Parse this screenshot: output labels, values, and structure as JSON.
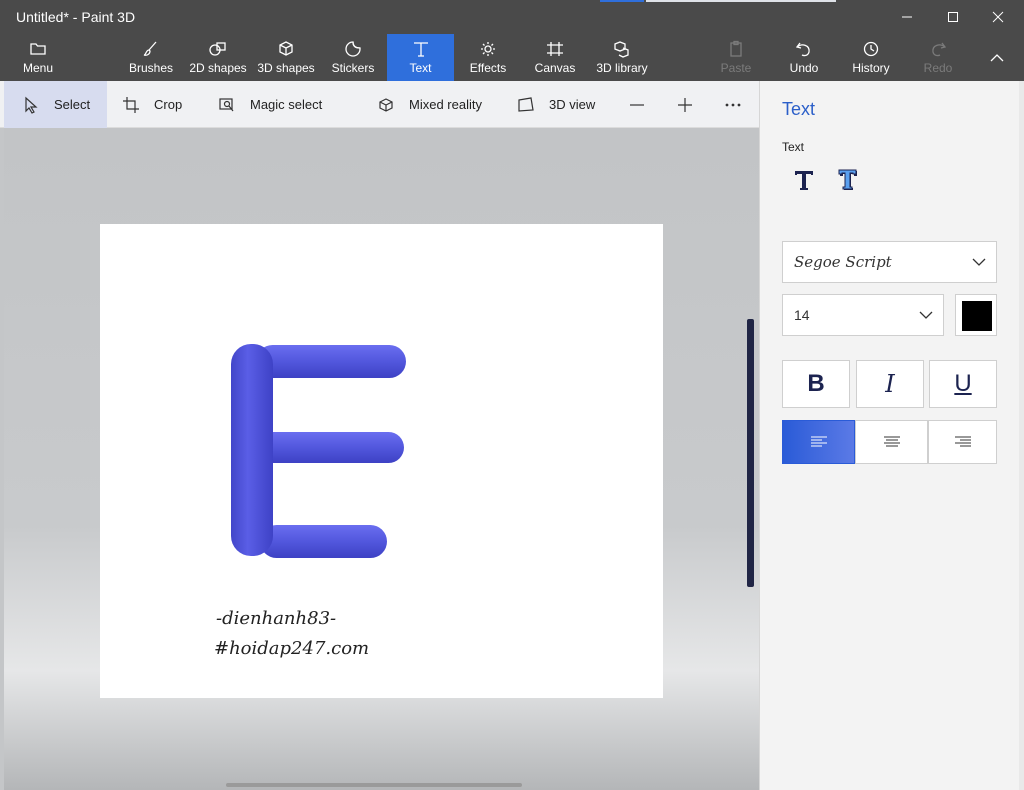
{
  "window": {
    "title": "Untitled* - Paint 3D"
  },
  "ribbon": {
    "items": [
      {
        "label": "Menu",
        "icon": "folder-icon"
      },
      {
        "label": "Brushes",
        "icon": "brush-icon"
      },
      {
        "label": "2D shapes",
        "icon": "2d-shapes-icon"
      },
      {
        "label": "3D shapes",
        "icon": "cube-icon"
      },
      {
        "label": "Stickers",
        "icon": "sticker-icon"
      },
      {
        "label": "Text",
        "icon": "text-icon",
        "active": true
      },
      {
        "label": "Effects",
        "icon": "sun-icon"
      },
      {
        "label": "Canvas",
        "icon": "canvas-icon"
      },
      {
        "label": "3D library",
        "icon": "library-icon"
      },
      {
        "label": "Paste",
        "icon": "paste-icon",
        "disabled": true
      },
      {
        "label": "Undo",
        "icon": "undo-icon"
      },
      {
        "label": "History",
        "icon": "history-icon"
      },
      {
        "label": "Redo",
        "icon": "redo-icon",
        "disabled": true
      }
    ]
  },
  "toolbar": {
    "select": "Select",
    "crop": "Crop",
    "magic_select": "Magic select",
    "mixed_reality": "Mixed reality",
    "view_3d": "3D view"
  },
  "canvas": {
    "watermark_line1": "-dienhanh83-",
    "watermark_line2": "#hoidap247.com",
    "letter_color": "#5257dd"
  },
  "panel": {
    "title": "Text",
    "section_label": "Text",
    "font_name": "Segoe Script",
    "font_size": "14",
    "text_color": "#000000",
    "bold_label": "B",
    "italic_label": "I",
    "underline_label": "U",
    "alignment": "left"
  },
  "colors": {
    "accent": "#2f6fdc",
    "ribbon_bg": "#4a4a4a"
  }
}
